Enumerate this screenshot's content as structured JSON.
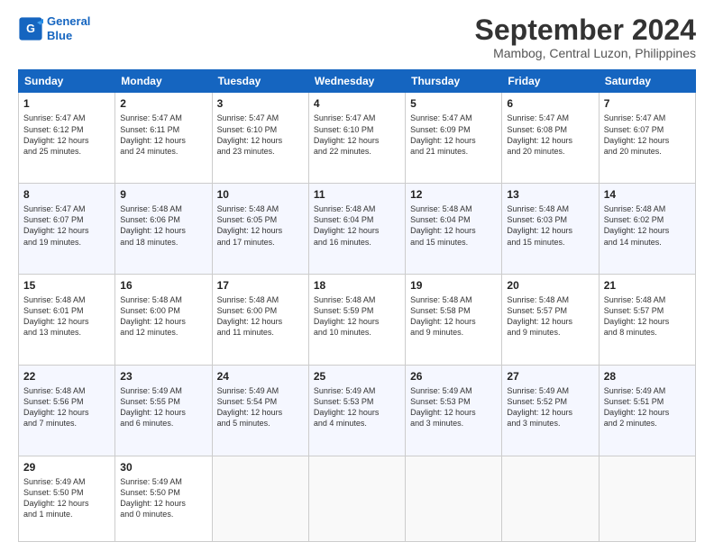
{
  "logo": {
    "line1": "General",
    "line2": "Blue"
  },
  "title": "September 2024",
  "location": "Mambog, Central Luzon, Philippines",
  "weekdays": [
    "Sunday",
    "Monday",
    "Tuesday",
    "Wednesday",
    "Thursday",
    "Friday",
    "Saturday"
  ],
  "weeks": [
    [
      {
        "day": "1",
        "info": "Sunrise: 5:47 AM\nSunset: 6:12 PM\nDaylight: 12 hours\nand 25 minutes."
      },
      {
        "day": "2",
        "info": "Sunrise: 5:47 AM\nSunset: 6:11 PM\nDaylight: 12 hours\nand 24 minutes."
      },
      {
        "day": "3",
        "info": "Sunrise: 5:47 AM\nSunset: 6:10 PM\nDaylight: 12 hours\nand 23 minutes."
      },
      {
        "day": "4",
        "info": "Sunrise: 5:47 AM\nSunset: 6:10 PM\nDaylight: 12 hours\nand 22 minutes."
      },
      {
        "day": "5",
        "info": "Sunrise: 5:47 AM\nSunset: 6:09 PM\nDaylight: 12 hours\nand 21 minutes."
      },
      {
        "day": "6",
        "info": "Sunrise: 5:47 AM\nSunset: 6:08 PM\nDaylight: 12 hours\nand 20 minutes."
      },
      {
        "day": "7",
        "info": "Sunrise: 5:47 AM\nSunset: 6:07 PM\nDaylight: 12 hours\nand 20 minutes."
      }
    ],
    [
      {
        "day": "8",
        "info": "Sunrise: 5:47 AM\nSunset: 6:07 PM\nDaylight: 12 hours\nand 19 minutes."
      },
      {
        "day": "9",
        "info": "Sunrise: 5:48 AM\nSunset: 6:06 PM\nDaylight: 12 hours\nand 18 minutes."
      },
      {
        "day": "10",
        "info": "Sunrise: 5:48 AM\nSunset: 6:05 PM\nDaylight: 12 hours\nand 17 minutes."
      },
      {
        "day": "11",
        "info": "Sunrise: 5:48 AM\nSunset: 6:04 PM\nDaylight: 12 hours\nand 16 minutes."
      },
      {
        "day": "12",
        "info": "Sunrise: 5:48 AM\nSunset: 6:04 PM\nDaylight: 12 hours\nand 15 minutes."
      },
      {
        "day": "13",
        "info": "Sunrise: 5:48 AM\nSunset: 6:03 PM\nDaylight: 12 hours\nand 15 minutes."
      },
      {
        "day": "14",
        "info": "Sunrise: 5:48 AM\nSunset: 6:02 PM\nDaylight: 12 hours\nand 14 minutes."
      }
    ],
    [
      {
        "day": "15",
        "info": "Sunrise: 5:48 AM\nSunset: 6:01 PM\nDaylight: 12 hours\nand 13 minutes."
      },
      {
        "day": "16",
        "info": "Sunrise: 5:48 AM\nSunset: 6:00 PM\nDaylight: 12 hours\nand 12 minutes."
      },
      {
        "day": "17",
        "info": "Sunrise: 5:48 AM\nSunset: 6:00 PM\nDaylight: 12 hours\nand 11 minutes."
      },
      {
        "day": "18",
        "info": "Sunrise: 5:48 AM\nSunset: 5:59 PM\nDaylight: 12 hours\nand 10 minutes."
      },
      {
        "day": "19",
        "info": "Sunrise: 5:48 AM\nSunset: 5:58 PM\nDaylight: 12 hours\nand 9 minutes."
      },
      {
        "day": "20",
        "info": "Sunrise: 5:48 AM\nSunset: 5:57 PM\nDaylight: 12 hours\nand 9 minutes."
      },
      {
        "day": "21",
        "info": "Sunrise: 5:48 AM\nSunset: 5:57 PM\nDaylight: 12 hours\nand 8 minutes."
      }
    ],
    [
      {
        "day": "22",
        "info": "Sunrise: 5:48 AM\nSunset: 5:56 PM\nDaylight: 12 hours\nand 7 minutes."
      },
      {
        "day": "23",
        "info": "Sunrise: 5:49 AM\nSunset: 5:55 PM\nDaylight: 12 hours\nand 6 minutes."
      },
      {
        "day": "24",
        "info": "Sunrise: 5:49 AM\nSunset: 5:54 PM\nDaylight: 12 hours\nand 5 minutes."
      },
      {
        "day": "25",
        "info": "Sunrise: 5:49 AM\nSunset: 5:53 PM\nDaylight: 12 hours\nand 4 minutes."
      },
      {
        "day": "26",
        "info": "Sunrise: 5:49 AM\nSunset: 5:53 PM\nDaylight: 12 hours\nand 3 minutes."
      },
      {
        "day": "27",
        "info": "Sunrise: 5:49 AM\nSunset: 5:52 PM\nDaylight: 12 hours\nand 3 minutes."
      },
      {
        "day": "28",
        "info": "Sunrise: 5:49 AM\nSunset: 5:51 PM\nDaylight: 12 hours\nand 2 minutes."
      }
    ],
    [
      {
        "day": "29",
        "info": "Sunrise: 5:49 AM\nSunset: 5:50 PM\nDaylight: 12 hours\nand 1 minute."
      },
      {
        "day": "30",
        "info": "Sunrise: 5:49 AM\nSunset: 5:50 PM\nDaylight: 12 hours\nand 0 minutes."
      },
      {
        "day": "",
        "info": ""
      },
      {
        "day": "",
        "info": ""
      },
      {
        "day": "",
        "info": ""
      },
      {
        "day": "",
        "info": ""
      },
      {
        "day": "",
        "info": ""
      }
    ]
  ]
}
